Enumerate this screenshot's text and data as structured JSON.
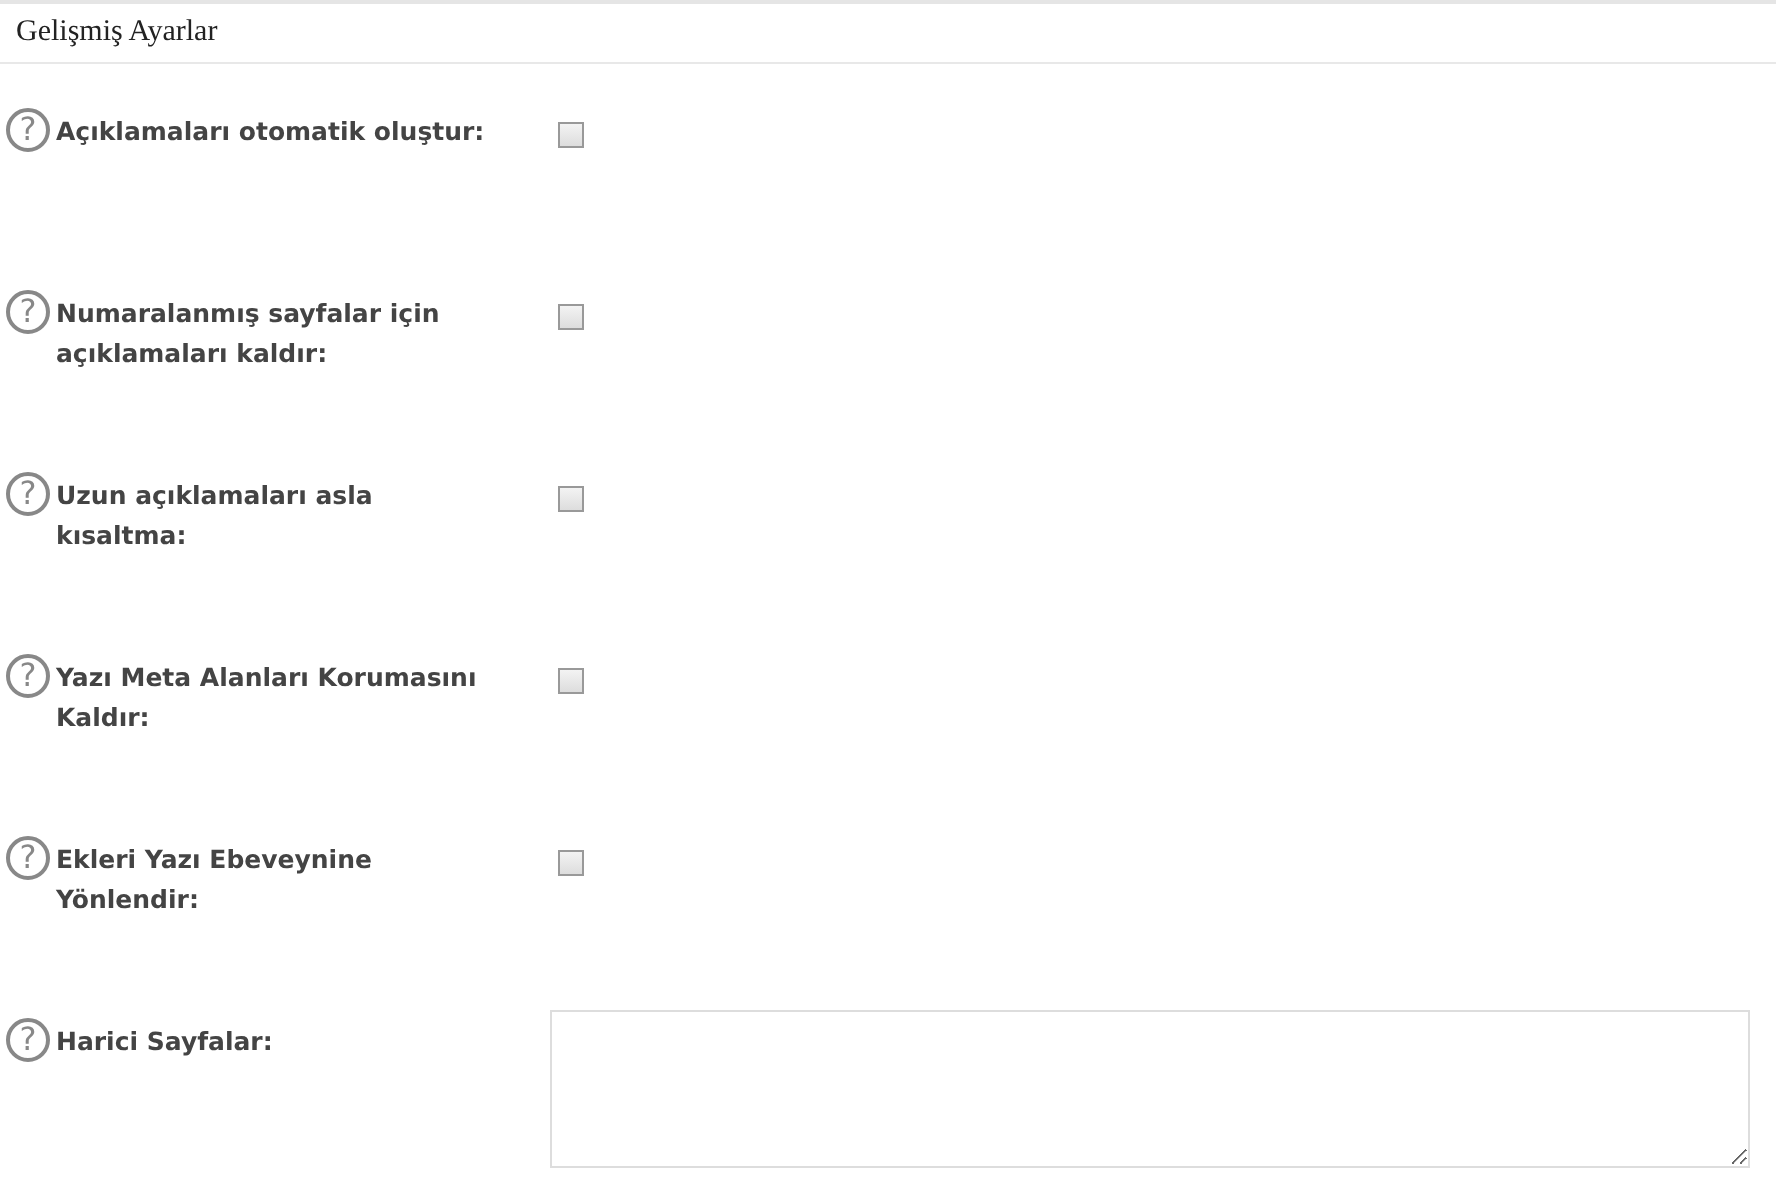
{
  "panel": {
    "title": "Gelişmiş Ayarlar"
  },
  "help_icon": "?",
  "settings": [
    {
      "kind": "checkbox",
      "label": "Açıklamaları otomatik oluştur:",
      "checked": false
    },
    {
      "kind": "checkbox",
      "label": "Numaralanmış sayfalar için açıklamaları kaldır:",
      "checked": false
    },
    {
      "kind": "checkbox",
      "label": "Uzun açıklamaları asla kısaltma:",
      "checked": false
    },
    {
      "kind": "checkbox",
      "label": "Yazı Meta Alanları Korumasını Kaldır:",
      "checked": false
    },
    {
      "kind": "checkbox",
      "label": "Ekleri Yazı Ebeveynine Yönlendir:",
      "checked": false
    },
    {
      "kind": "textarea",
      "label": "Harici Sayfalar:"
    }
  ]
}
